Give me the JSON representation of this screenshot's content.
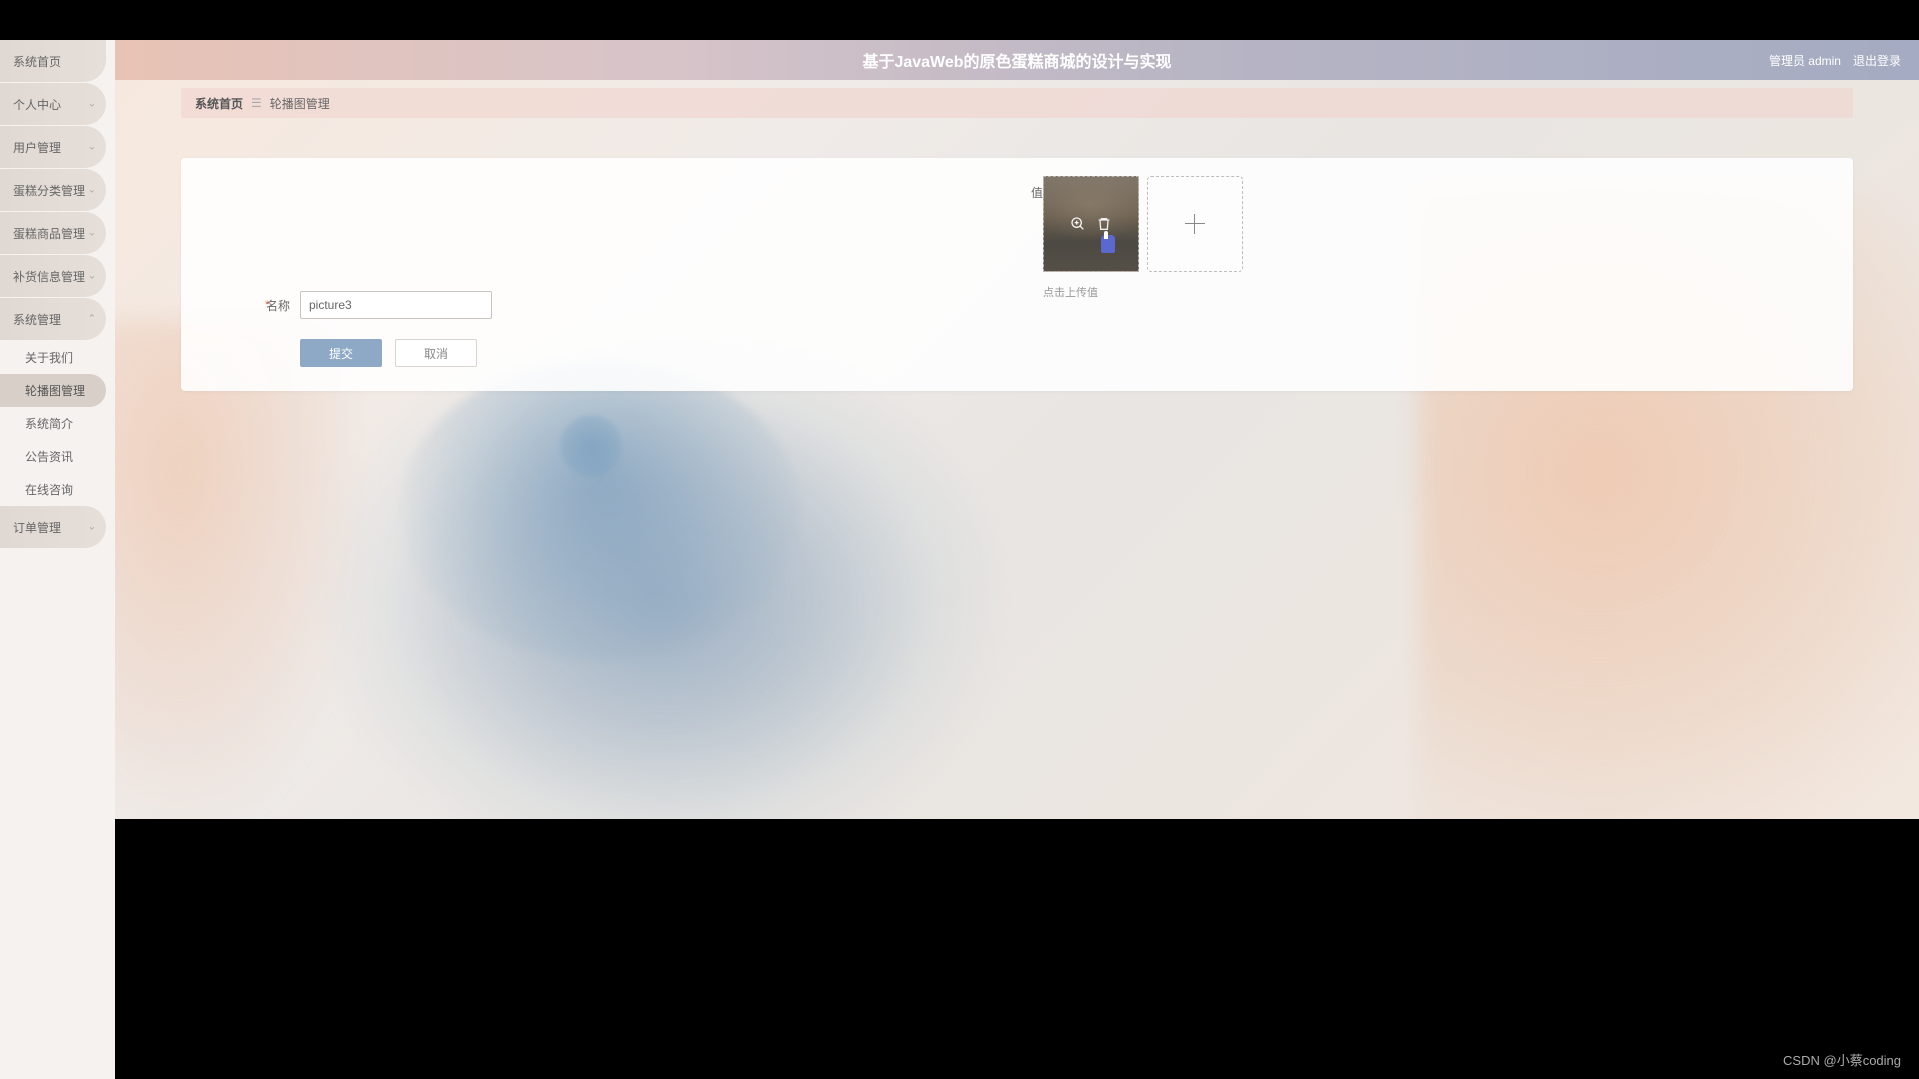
{
  "header": {
    "title": "基于JavaWeb的原色蛋糕商城的设计与实现",
    "role": "管理员",
    "user": "admin",
    "logout": "退出登录"
  },
  "sidebar": {
    "items": [
      {
        "label": "系统首页",
        "expandable": false
      },
      {
        "label": "个人中心",
        "expandable": true
      },
      {
        "label": "用户管理",
        "expandable": true
      },
      {
        "label": "蛋糕分类管理",
        "expandable": true
      },
      {
        "label": "蛋糕商品管理",
        "expandable": true
      },
      {
        "label": "补货信息管理",
        "expandable": true
      },
      {
        "label": "系统管理",
        "expandable": true,
        "expanded": true,
        "children": [
          {
            "label": "关于我们"
          },
          {
            "label": "轮播图管理",
            "active": true
          },
          {
            "label": "系统简介"
          },
          {
            "label": "公告资讯"
          },
          {
            "label": "在线咨询"
          }
        ]
      },
      {
        "label": "订单管理",
        "expandable": true
      }
    ]
  },
  "breadcrumb": {
    "home": "系统首页",
    "current": "轮播图管理"
  },
  "form": {
    "name_label": "名称",
    "name_value": "picture3",
    "value_label": "值",
    "upload_hint": "点击上传值",
    "submit": "提交",
    "cancel": "取消"
  },
  "watermark": "CSDN @小蔡coding"
}
